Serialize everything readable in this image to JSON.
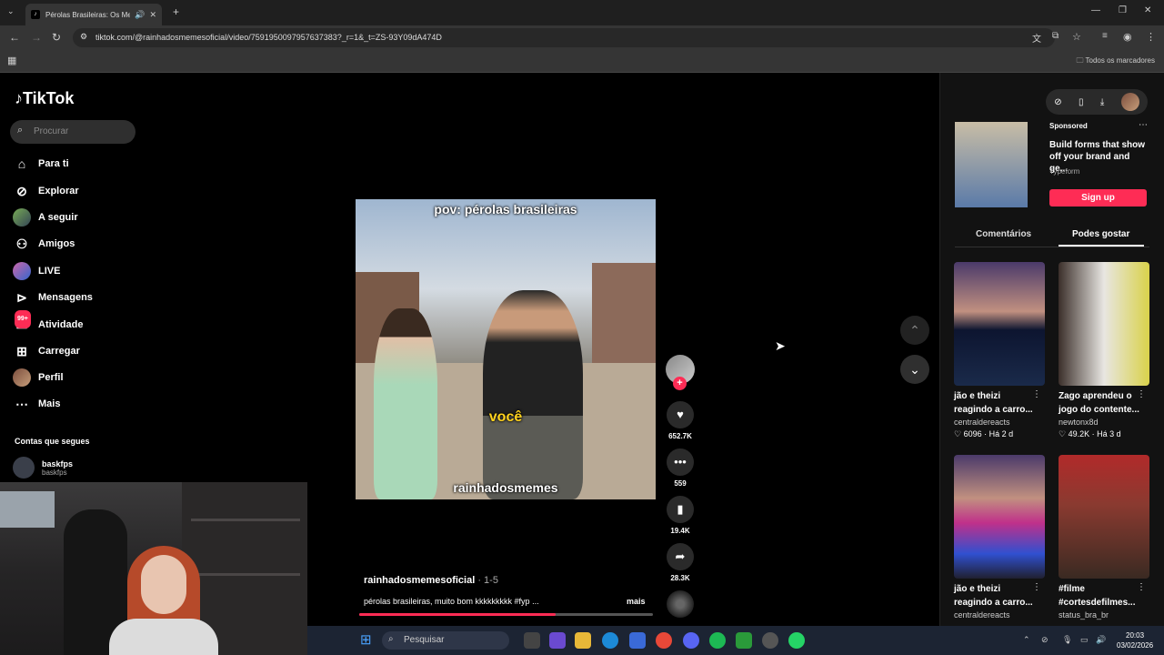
{
  "browser": {
    "tab_title": "Pérolas Brasileiras: Os Melh",
    "url": "tiktok.com/@rainhadosmemesoficial/video/7591950097957637383?_r=1&_t=ZS-93Y09dA474D",
    "bookmarks_label": "Todos os marcadores"
  },
  "sidebar": {
    "logo": "TikTok",
    "search_placeholder": "Procurar",
    "items": [
      {
        "label": "Para ti"
      },
      {
        "label": "Explorar"
      },
      {
        "label": "A seguir"
      },
      {
        "label": "Amigos"
      },
      {
        "label": "LIVE"
      },
      {
        "label": "Mensagens"
      },
      {
        "label": "Atividade",
        "badge": "99+"
      },
      {
        "label": "Carregar"
      },
      {
        "label": "Perfil"
      },
      {
        "label": "Mais"
      }
    ],
    "following_title": "Contas que segues",
    "following": [
      {
        "name": "baskfps",
        "handle": "baskfps"
      }
    ]
  },
  "video": {
    "caption_top": "pov: pérolas brasileiras",
    "caption_mid": "você",
    "caption_bottom": "rainhadosmemes",
    "author": "rainhadosmemesoficial",
    "date": " · 1-5",
    "description": "pérolas brasileiras, muito bom kkkkkkkkk #fyp ...",
    "more": "mais",
    "progress": 0.67,
    "likes": "652.7K",
    "comments": "559",
    "saves": "19.4K",
    "shares": "28.3K"
  },
  "right_panel": {
    "ad": {
      "sponsored": "Sponsored",
      "text": "Build forms that show off your brand and ge...",
      "brand": "Typeform",
      "cta": "Sign up"
    },
    "tabs": [
      "Comentários",
      "Podes gostar"
    ],
    "cards": [
      {
        "title": "jão e theizi\nreagindo a carro...",
        "user": "centraldereacts",
        "meta": "♡ 6096 · Há 2 d"
      },
      {
        "title": "Zago aprendeu o\njogo do contente...",
        "user": "newtonx8d",
        "meta": "♡ 49.2K · Há 3 d"
      },
      {
        "title": "jão e theizi\nreagindo a carro...",
        "user": "centraldereacts",
        "meta": ""
      },
      {
        "title": "#filme\n#cortesdefilmes...",
        "user": "status_bra_br",
        "meta": ""
      }
    ]
  },
  "taskbar": {
    "search": "Pesquisar",
    "time": "20:03",
    "date": "03/02/2026"
  }
}
